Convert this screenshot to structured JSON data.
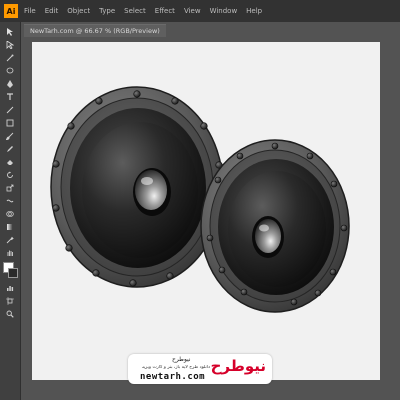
{
  "app": {
    "logo_text": "Ai",
    "menu": [
      "File",
      "Edit",
      "Object",
      "Type",
      "Select",
      "Effect",
      "View",
      "Window",
      "Help"
    ]
  },
  "document_tab": {
    "label": "NewTarh.com @ 66.67 % (RGB/Preview)"
  },
  "toolbar": {
    "tools": [
      "selection-icon",
      "direct-selection-icon",
      "magic-wand-icon",
      "lasso-icon",
      "pen-icon",
      "type-icon",
      "line-icon",
      "rectangle-icon",
      "paintbrush-icon",
      "pencil-icon",
      "eraser-icon",
      "rotate-icon",
      "scale-icon",
      "width-icon",
      "free-transform-icon",
      "shape-builder-icon",
      "perspective-icon",
      "mesh-icon",
      "gradient-icon",
      "eyedropper-icon",
      "blend-icon",
      "symbol-sprayer-icon",
      "column-graph-icon",
      "artboard-icon",
      "slice-icon",
      "hand-icon",
      "zoom-icon"
    ],
    "fill_color": "#ffffff",
    "stroke_color": "#2a2a2a"
  },
  "artwork": {
    "description_colors": {
      "rim": "#5e5e5e",
      "cone": "#1b1b1b",
      "dome_highlight": "#d0d0d0"
    }
  },
  "watermark": {
    "brand": "نیوطرح",
    "small_title": "نیوطرح",
    "tagline": "دانلود طرح لایه باز، بنر و کارت ویزیت",
    "domain": "newtarh.com"
  }
}
